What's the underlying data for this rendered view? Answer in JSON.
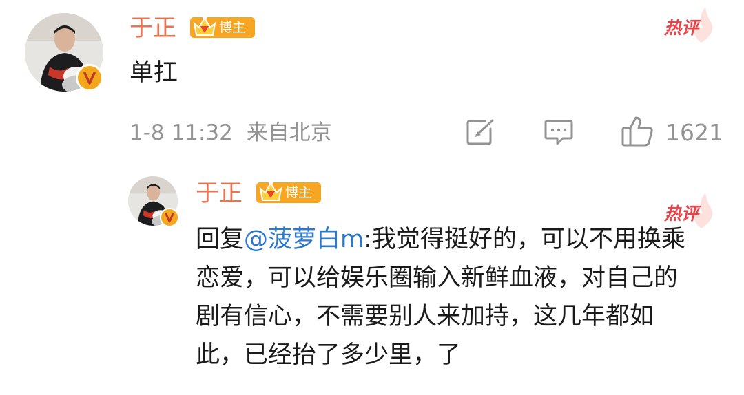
{
  "comment": {
    "username": "于正",
    "badge_label": "博主",
    "hot_label": "热评",
    "text": "单扛",
    "time": "1-8 11:32",
    "location": "来自北京",
    "like_count": "1621"
  },
  "reply": {
    "username": "于正",
    "badge_label": "博主",
    "hot_label": "热评",
    "prefix": "回复",
    "mention": "@菠萝白m",
    "text": ":我觉得挺好的，可以不用换乘恋爱，可以给娱乐圈输入新鲜血液，对自己的剧有信心，不需要别人来加持，这几年都如此，已经抬了多少里，了"
  },
  "colors": {
    "username": "#eb7350",
    "badge": "#f7a623",
    "hot": "#e8444a",
    "mention": "#2d78c8",
    "meta": "#939393"
  },
  "icons": {
    "repost": "repost-icon",
    "comment": "comment-icon",
    "like": "like-icon",
    "verified": "verified-v-icon",
    "crown": "crown-icon"
  }
}
